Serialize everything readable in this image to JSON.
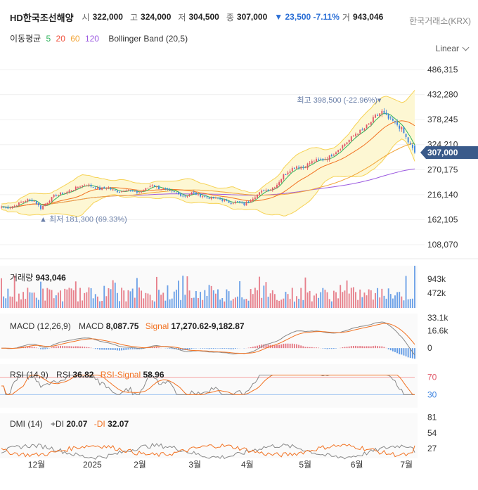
{
  "header": {
    "name": "HD한국조선해양",
    "open_label": "시",
    "open": "322,000",
    "high_label": "고",
    "high": "324,000",
    "low_label": "저",
    "low": "304,500",
    "close_label": "종",
    "close": "307,000",
    "change": "▼ 23,500 -7.11%",
    "volume_label": "거",
    "volume": "943,046",
    "exchange": "한국거래소(KRX)"
  },
  "legend": {
    "ma_label": "이동평균",
    "ma5": "5",
    "ma20": "20",
    "ma60": "60",
    "ma120": "120",
    "bb_label": "Bollinger Band (20,5)"
  },
  "scale_mode": "Linear",
  "colors": {
    "up": "#e05767",
    "down": "#3c83e0",
    "ma5": "#2db35b",
    "ma20": "#f27222",
    "ma60": "#f2a436",
    "ma120": "#9b59e0",
    "band_fill": "#fdf7d3",
    "band_line": "#f6d255",
    "current": "#3a5a8a"
  },
  "price_panel": {
    "y_ticks": [
      "486,315",
      "432,280",
      "378,245",
      "324,210",
      "270,175",
      "216,140",
      "162,105",
      "108,070"
    ],
    "current_price": "307,000",
    "max_label": "최고 398,500 (-22.96%)▾",
    "min_label": "▲ 최저 181,300 (69.33%)"
  },
  "volume_panel": {
    "title": "거래량",
    "value": "943,046",
    "ticks": [
      "943k",
      "472k"
    ]
  },
  "macd_panel": {
    "title": "MACD (12,26,9)",
    "macd_label": "MACD",
    "macd_value": "8,087.75",
    "signal_label": "Signal",
    "signal_value": "17,270.62-9,182.87",
    "ticks": [
      "33.1k",
      "16.6k",
      "0"
    ]
  },
  "rsi_panel": {
    "title": "RSI (14,9)",
    "rsi_label": "RSI",
    "rsi_value": "36.82",
    "signal_label": "RSI-Signal",
    "signal_value": "58.96",
    "ticks": [
      "70",
      "30"
    ]
  },
  "dmi_panel": {
    "title": "DMI (14)",
    "pdi_label": "+DI",
    "pdi_value": "20.07",
    "mdi_label": "-DI",
    "mdi_value": "32.07",
    "ticks": [
      "81",
      "54",
      "27"
    ]
  },
  "x_labels": [
    "12월",
    "2025",
    "2월",
    "3월",
    "4월",
    "5월",
    "6월",
    "7월"
  ],
  "chart_data": {
    "type": "candlestick",
    "title": "HD한국조선해양",
    "ylim": [
      108070,
      486315
    ],
    "x_axis": [
      "12월",
      "2025",
      "2월",
      "3월",
      "4월",
      "5월",
      "6월",
      "7월"
    ],
    "price_anchors": [
      190000,
      188000,
      192000,
      200000,
      205000,
      203000,
      187000,
      200000,
      213000,
      218000,
      222000,
      228000,
      235000,
      238000,
      233000,
      228000,
      232000,
      226000,
      222000,
      228000,
      222000,
      221000,
      228000,
      238000,
      230000,
      226000,
      222000,
      217000,
      213000,
      220000,
      216000,
      212000,
      208000,
      208000,
      203000,
      198000,
      201000,
      195000,
      206000,
      216000,
      226000,
      228000,
      238000,
      258000,
      270000,
      278000,
      275000,
      285000,
      290000,
      292000,
      298000,
      310000,
      322000,
      334000,
      348000,
      355000,
      368000,
      385000,
      395000,
      380000,
      372000,
      358000,
      330000,
      307000
    ],
    "period_high": 398500,
    "period_low": 181300,
    "volume_max": 943046,
    "last_candle": {
      "open": 322000,
      "high": 324000,
      "low": 304500,
      "close": 307000,
      "volume": 943046
    },
    "macd": {
      "macd": 8087.75,
      "signal": 17270.62,
      "histogram": -9182.87,
      "ylim": [
        -10000,
        33100
      ]
    },
    "rsi": {
      "rsi": 36.82,
      "signal": 58.96,
      "bands": [
        30,
        70
      ]
    },
    "dmi": {
      "plus_di": 20.07,
      "minus_di": 32.07,
      "ticks": [
        27,
        54,
        81
      ]
    }
  }
}
